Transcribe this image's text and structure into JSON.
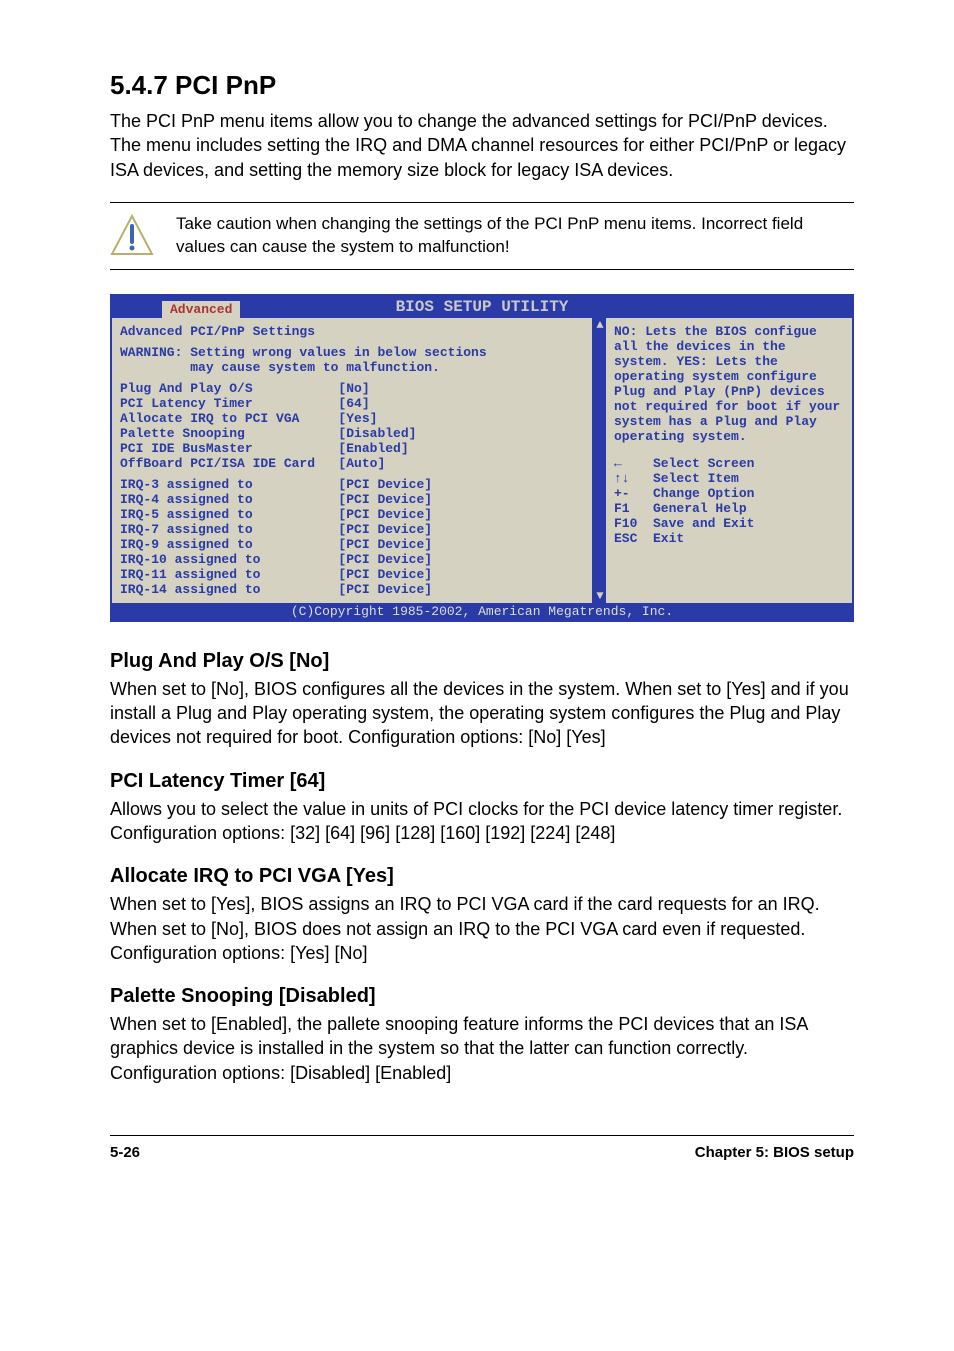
{
  "section_number_title": "5.4.7   PCI PnP",
  "intro_paragraph": "The PCI PnP menu items allow you to change the advanced settings for PCI/PnP devices. The menu includes setting the IRQ and DMA channel resources for either PCI/PnP or legacy ISA devices, and setting the memory size block for legacy ISA devices.",
  "caution_text": "Take caution when changing the settings of the PCI PnP menu items. Incorrect field values can cause the system to malfunction!",
  "bios": {
    "header_title": "BIOS SETUP UTILITY",
    "tab_label": "Advanced",
    "panel_title": "Advanced PCI/PnP Settings",
    "warning_line1": "WARNING: Setting wrong values in below sections",
    "warning_line2": "         may cause system to malfunction.",
    "settings": [
      {
        "label": "Plug And Play O/S",
        "value": "[No]"
      },
      {
        "label": "PCI Latency Timer",
        "value": "[64]"
      },
      {
        "label": "Allocate IRQ to PCI VGA",
        "value": "[Yes]"
      },
      {
        "label": "Palette Snooping",
        "value": "[Disabled]"
      },
      {
        "label": "PCI IDE BusMaster",
        "value": "[Enabled]"
      },
      {
        "label": "OffBoard PCI/ISA IDE Card",
        "value": "[Auto]"
      }
    ],
    "irqs": [
      {
        "label": "IRQ-3 assigned to",
        "value": "[PCI Device]"
      },
      {
        "label": "IRQ-4 assigned to",
        "value": "[PCI Device]"
      },
      {
        "label": "IRQ-5 assigned to",
        "value": "[PCI Device]"
      },
      {
        "label": "IRQ-7 assigned to",
        "value": "[PCI Device]"
      },
      {
        "label": "IRQ-9 assigned to",
        "value": "[PCI Device]"
      },
      {
        "label": "IRQ-10 assigned to",
        "value": "[PCI Device]"
      },
      {
        "label": "IRQ-11 assigned to",
        "value": "[PCI Device]"
      },
      {
        "label": "IRQ-14 assigned to",
        "value": "[PCI Device]"
      }
    ],
    "help_text": "NO: Lets the BIOS configue all the devices in the system. YES: Lets the operating system configure Plug and Play (PnP) devices not required for boot if your system has a Plug and Play operating system.",
    "legend": [
      "←    Select Screen",
      "↑↓   Select Item",
      "+-   Change Option",
      "F1   General Help",
      "F10  Save and Exit",
      "ESC  Exit"
    ],
    "footer": "(C)Copyright 1985-2002, American Megatrends, Inc."
  },
  "subs": {
    "plug_title": "Plug And Play O/S [No]",
    "plug_body": "When set to [No], BIOS configures all the devices in the system. When set to [Yes] and if you install a Plug and Play operating system, the operating system configures the Plug and Play devices not required for boot. Configuration options: [No] [Yes]",
    "latency_title": "PCI Latency Timer [64]",
    "latency_body": "Allows you to select the value in units of PCI clocks for the PCI device latency timer register. Configuration options: [32] [64] [96] [128] [160] [192] [224] [248]",
    "allocate_title": "Allocate IRQ to PCI VGA [Yes]",
    "allocate_body": "When set to [Yes], BIOS assigns an IRQ to PCI VGA card if the card requests for an IRQ. When set to [No], BIOS does not assign an IRQ to the PCI VGA card even if requested. Configuration options: [Yes] [No]",
    "palette_title": "Palette Snooping [Disabled]",
    "palette_body": "When set to [Enabled], the pallete snooping feature informs the PCI devices that an ISA graphics device is installed in the system so that the latter can function correctly. Configuration options: [Disabled] [Enabled]"
  },
  "footer_left": "5-26",
  "footer_right": "Chapter 5: BIOS setup"
}
